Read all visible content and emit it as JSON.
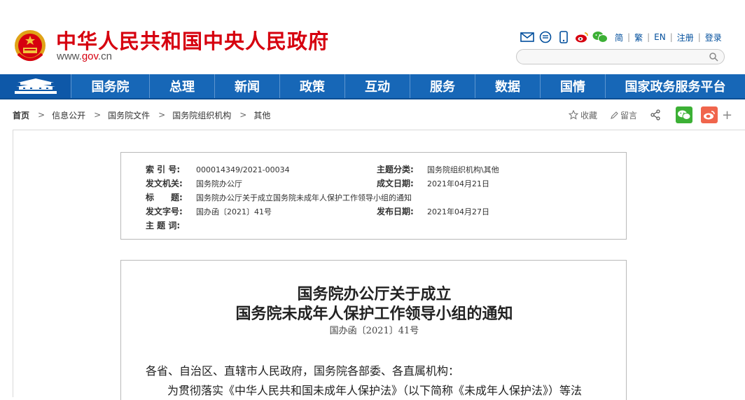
{
  "header": {
    "site_title": "中华人民共和国中央人民政府",
    "domain_pre": "www.",
    "domain_red": "gov",
    "domain_post": ".cn",
    "lang": {
      "simplified": "简",
      "traditional": "繁",
      "english": "EN",
      "register": "注册",
      "login": "登录"
    },
    "search_placeholder": ""
  },
  "nav": {
    "items": [
      "国务院",
      "总理",
      "新闻",
      "政策",
      "互动",
      "服务",
      "数据",
      "国情",
      "国家政务服务平台"
    ],
    "bg_color": "#1767b7"
  },
  "breadcrumb": [
    "首页",
    "信息公开",
    "国务院文件",
    "国务院组织机构",
    "其他"
  ],
  "share": {
    "favorite": "收藏",
    "comment": "留言",
    "more": "+"
  },
  "meta": {
    "index_label": "索 引 号:",
    "index_value": "000014349/2021-00034",
    "topic_label": "主题分类:",
    "topic_value": "国务院组织机构\\其他",
    "issuer_label": "发文机关:",
    "issuer_value": "国务院办公厅",
    "written_label": "成文日期:",
    "written_value": "2021年04月21日",
    "title_label": "标　　题:",
    "title_value": "国务院办公厅关于成立国务院未成年人保护工作领导小组的通知",
    "docno_label": "发文字号:",
    "docno_value": "国办函〔2021〕41号",
    "published_label": "发布日期:",
    "published_value": "2021年04月27日",
    "keywords_label": "主 题 词:",
    "keywords_value": ""
  },
  "article": {
    "title_line1": "国务院办公厅关于成立",
    "title_line2": "国务院未成年人保护工作领导小组的通知",
    "doc_number": "国办函〔2021〕41号",
    "salutation": "各省、自治区、直辖市人民政府，国务院各部委、各直属机构：",
    "body_start": "为贯彻落实《中华人民共和国未成年人保护法》（以下简称《未成年人保护法》）等法"
  },
  "colors": {
    "brand_red": "#d6000f",
    "link_blue": "#004e9c",
    "wechat_green": "#3cb035",
    "weibo_orange": "#f0654c"
  }
}
